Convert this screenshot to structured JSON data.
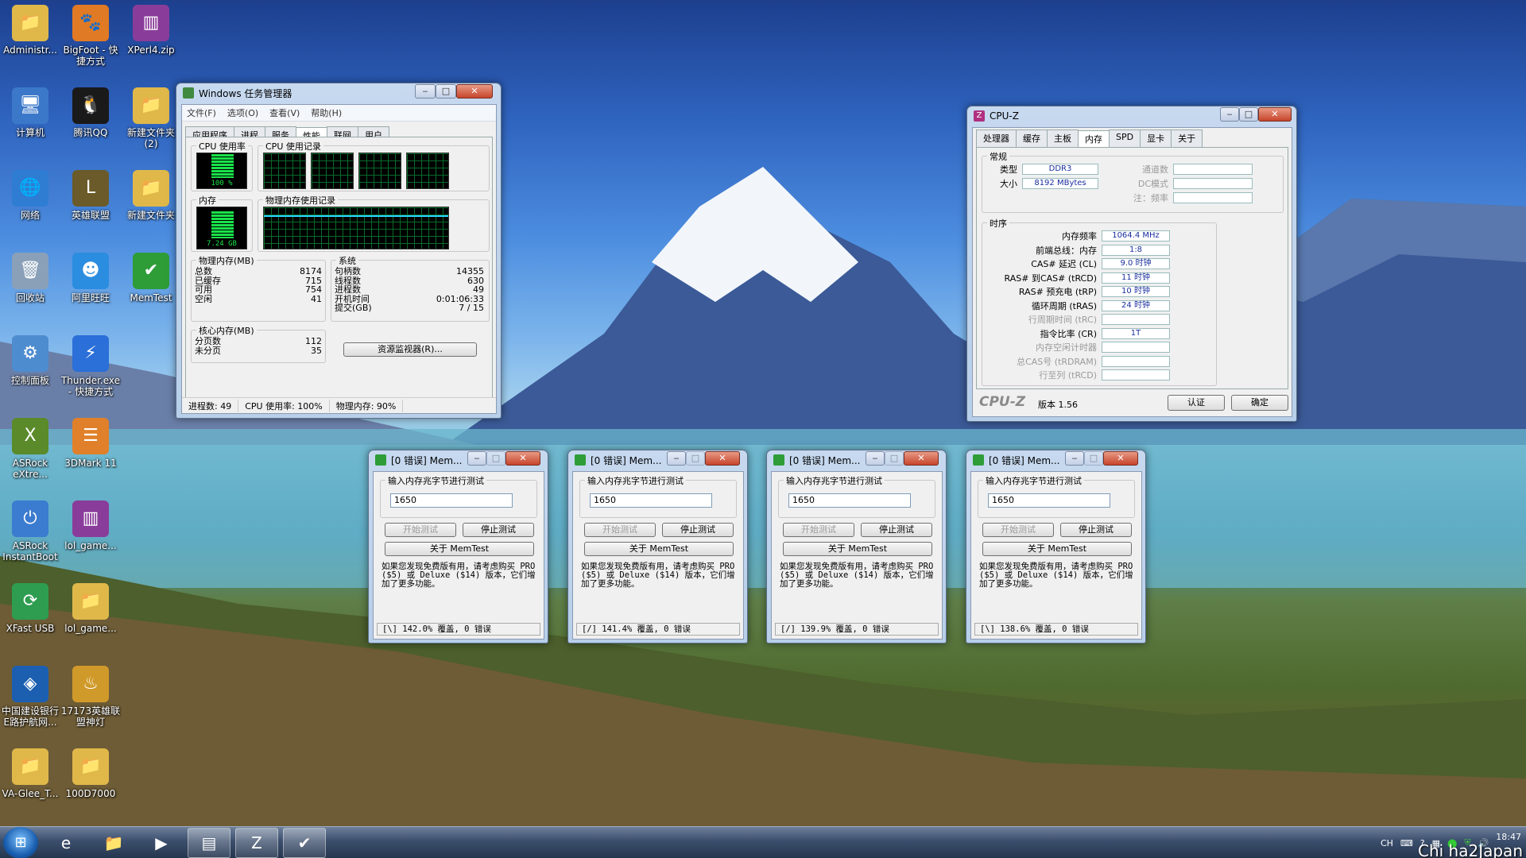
{
  "desktop": {
    "icons": [
      {
        "label": "Administr...",
        "icon": "user-folder-icon",
        "color": "#e0b84a",
        "glyph": "📁"
      },
      {
        "label": "BigFoot - 快\n捷方式",
        "icon": "bigfoot-icon",
        "color": "#e07a24",
        "glyph": "🐾"
      },
      {
        "label": "XPerl4.zip",
        "icon": "winrar-icon",
        "color": "#8a3c9a",
        "glyph": "▥"
      },
      {
        "label": "计算机",
        "icon": "computer-icon",
        "color": "#3b78c9",
        "glyph": "🖥"
      },
      {
        "label": "腾讯QQ",
        "icon": "qq-icon",
        "color": "#1a1a1a",
        "glyph": "🐧"
      },
      {
        "label": "新建文件夹\n(2)",
        "icon": "folder-icon",
        "color": "#e0b84a",
        "glyph": "📁"
      },
      {
        "label": "网络",
        "icon": "network-icon",
        "color": "#2e7dd3",
        "glyph": "🌐"
      },
      {
        "label": "英雄联盟",
        "icon": "lol-icon",
        "color": "#6b5a2a",
        "glyph": "L"
      },
      {
        "label": "新建文件夹",
        "icon": "folder-icon",
        "color": "#e0b84a",
        "glyph": "📁"
      },
      {
        "label": "回收站",
        "icon": "recycle-bin-icon",
        "color": "#8aa0b8",
        "glyph": "🗑"
      },
      {
        "label": "阿里旺旺",
        "icon": "aliwangwang-icon",
        "color": "#2b8de0",
        "glyph": "☻"
      },
      {
        "label": "MemTest",
        "icon": "memtest-icon",
        "color": "#2e9d38",
        "glyph": "✔"
      },
      {
        "label": "控制面板",
        "icon": "control-panel-icon",
        "color": "#4e8cd0",
        "glyph": "⚙"
      },
      {
        "label": "Thunder.exe\n- 快捷方式",
        "icon": "thunder-icon",
        "color": "#2b6fd8",
        "glyph": "⚡"
      },
      {
        "label": "ASRock\neXtre...",
        "icon": "asrock-xtu-icon",
        "color": "#5a8a2a",
        "glyph": "X"
      },
      {
        "label": "3DMark 11",
        "icon": "3dmark-icon",
        "color": "#e0802a",
        "glyph": "☰"
      },
      {
        "label": "ASRock\nInstantBoot",
        "icon": "asrock-instantboot-icon",
        "color": "#3b7bd0",
        "glyph": "⏻"
      },
      {
        "label": "lol_game...",
        "icon": "winrar-icon",
        "color": "#8a3c9a",
        "glyph": "▥"
      },
      {
        "label": "XFast USB",
        "icon": "xfast-usb-icon",
        "color": "#2e9d50",
        "glyph": "⟳"
      },
      {
        "label": "lol_game...",
        "icon": "folder-icon",
        "color": "#e0b84a",
        "glyph": "📁"
      },
      {
        "label": "中国建设银行\nE路护航网...",
        "icon": "ccb-icon",
        "color": "#1c5fb0",
        "glyph": "◈"
      },
      {
        "label": "17173英雄联\n盟神灯",
        "icon": "lamp-icon",
        "color": "#d09a2a",
        "glyph": "♨"
      },
      {
        "label": "VA-Glee_T...",
        "icon": "folder-icon",
        "color": "#e0b84a",
        "glyph": "📁"
      },
      {
        "label": "100D7000",
        "icon": "folder-icon",
        "color": "#e0b84a",
        "glyph": "📁"
      }
    ]
  },
  "taskmgr": {
    "title": "Windows 任务管理器",
    "menu": [
      "文件(F)",
      "选项(O)",
      "查看(V)",
      "帮助(H)"
    ],
    "tabs": [
      "应用程序",
      "进程",
      "服务",
      "性能",
      "联网",
      "用户"
    ],
    "cpu_usage_label": "CPU 使用率",
    "cpu_history_label": "CPU 使用记录",
    "cpu_value": "100 %",
    "mem_label": "内存",
    "mem_history_label": "物理内存使用记录",
    "mem_value": "7.24 GB",
    "phys_title": "物理内存(MB)",
    "phys": [
      [
        "总数",
        "8174"
      ],
      [
        "已缓存",
        "715"
      ],
      [
        "可用",
        "754"
      ],
      [
        "空闲",
        "41"
      ]
    ],
    "kernel_title": "核心内存(MB)",
    "kernel": [
      [
        "分页数",
        "112"
      ],
      [
        "未分页",
        "35"
      ]
    ],
    "sys_title": "系统",
    "sys": [
      [
        "句柄数",
        "14355"
      ],
      [
        "线程数",
        "630"
      ],
      [
        "进程数",
        "49"
      ],
      [
        "开机时间",
        "0:01:06:33"
      ],
      [
        "提交(GB)",
        "7 / 15"
      ]
    ],
    "resmon_button": "资源监视器(R)...",
    "status": [
      "进程数: 49",
      "CPU 使用率: 100%",
      "物理内存: 90%"
    ],
    "cpu_level": 1.0,
    "mem_level": 0.9
  },
  "cpuz": {
    "title": "CPU-Z",
    "tabs": [
      "处理器",
      "缓存",
      "主板",
      "内存",
      "SPD",
      "显卡",
      "关于"
    ],
    "general_title": "常规",
    "type_label": "类型",
    "type_value": "DDR3",
    "size_label": "大小",
    "size_value": "8192 MBytes",
    "channels_label": "通道数",
    "dc_label": "DC模式",
    "note_label": "注：频率",
    "timing_title": "时序",
    "timings": [
      {
        "label": "内存频率",
        "value": "1064.4 MHz",
        "dim": false
      },
      {
        "label": "前端总线：内存",
        "value": "1:8",
        "dim": false
      },
      {
        "label": "CAS# 延迟 (CL)",
        "value": "9.0 时钟",
        "dim": false
      },
      {
        "label": "RAS# 到CAS# (tRCD)",
        "value": "11 时钟",
        "dim": false
      },
      {
        "label": "RAS# 预充电 (tRP)",
        "value": "10 时钟",
        "dim": false
      },
      {
        "label": "循环周期 (tRAS)",
        "value": "24 时钟",
        "dim": false
      },
      {
        "label": "行周期时间 (tRC)",
        "value": "",
        "dim": true
      },
      {
        "label": "指令比率 (CR)",
        "value": "1T",
        "dim": false
      },
      {
        "label": "内存空闲计时器",
        "value": "",
        "dim": true
      },
      {
        "label": "总CAS号 (tRDRAM)",
        "value": "",
        "dim": true
      },
      {
        "label": "行至列 (tRCD)",
        "value": "",
        "dim": true
      }
    ],
    "brand": "CPU-Z",
    "version": "版本 1.56",
    "validate_button": "认证",
    "ok_button": "确定"
  },
  "memtest": [
    {
      "title": "[0 错误] Mem...",
      "prompt": "输入内存兆字节进行测试",
      "value": "1650",
      "start": "开始测试",
      "stop": "停止测试",
      "about": "关于 MemTest",
      "note": "如果您发现免费版有用，请考虑购买 PRO ($5) 或 Deluxe ($14) 版本，它们增加了更多功能。",
      "status": "[\\]  142.0% 覆盖, 0 错误"
    },
    {
      "title": "[0 错误] Mem...",
      "prompt": "输入内存兆字节进行测试",
      "value": "1650",
      "start": "开始测试",
      "stop": "停止测试",
      "about": "关于 MemTest",
      "note": "如果您发现免费版有用，请考虑购买 PRO ($5) 或 Deluxe ($14) 版本，它们增加了更多功能。",
      "status": "[/]  141.4% 覆盖, 0 错误"
    },
    {
      "title": "[0 错误] Mem...",
      "prompt": "输入内存兆字节进行测试",
      "value": "1650",
      "start": "开始测试",
      "stop": "停止测试",
      "about": "关于 MemTest",
      "note": "如果您发现免费版有用，请考虑购买 PRO ($5) 或 Deluxe ($14) 版本，它们增加了更多功能。",
      "status": "[/]  139.9% 覆盖, 0 错误"
    },
    {
      "title": "[0 错误] Mem...",
      "prompt": "输入内存兆字节进行测试",
      "value": "1650",
      "start": "开始测试",
      "stop": "停止测试",
      "about": "关于 MemTest",
      "note": "如果您发现免费版有用，请考虑购买 PRO ($5) 或 Deluxe ($14) 版本，它们增加了更多功能。",
      "status": "[\\]  138.6% 覆盖, 0 错误"
    }
  ],
  "taskbar": {
    "items": [
      {
        "icon": "ie-icon",
        "glyph": "e",
        "open": false
      },
      {
        "icon": "explorer-icon",
        "glyph": "📁",
        "open": false
      },
      {
        "icon": "media-player-icon",
        "glyph": "▶",
        "open": false
      },
      {
        "icon": "task-manager-icon",
        "glyph": "▤",
        "open": true
      },
      {
        "icon": "cpuz-icon",
        "glyph": "Z",
        "open": true
      },
      {
        "icon": "memtest-icon",
        "glyph": "✔",
        "open": true
      }
    ],
    "lang": "CH",
    "time": "18:47",
    "watermark": "Chi ha2Japan"
  }
}
